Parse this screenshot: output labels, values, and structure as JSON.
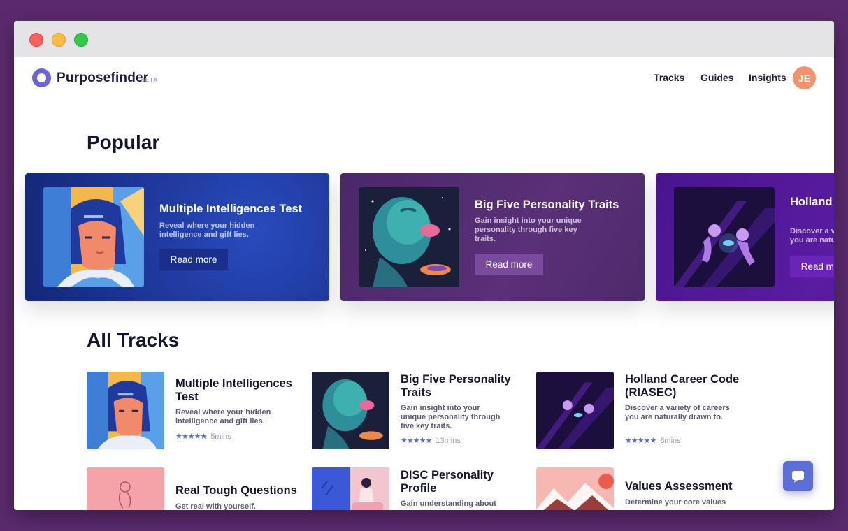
{
  "window": {
    "buttons": [
      "close",
      "minimize",
      "zoom"
    ]
  },
  "nav": {
    "brand": "Purposefinder",
    "badge": "BETA",
    "links": [
      "Tracks",
      "Guides",
      "Insights"
    ],
    "avatar_initials": "JE"
  },
  "popular": {
    "heading": "Popular",
    "cards": [
      {
        "title": "Multiple Intelligences Test",
        "description": "Reveal where your hidden intelligence and gift lies.",
        "button": "Read more",
        "bg": "#1d3a9e",
        "button_bg": "#1a2f8c"
      },
      {
        "title": "Big Five Personality Traits",
        "description": "Gain insight into your unique personality through five key traits.",
        "button": "Read more",
        "bg": "#4f2a6d",
        "button_bg": "#7a4a9c"
      },
      {
        "title": "Holland Career Code (RIASEC)",
        "description": "Discover a variety of careers you are naturally drawn to.",
        "button": "Read more",
        "bg": "#4a1690",
        "button_bg": "#6a24b8"
      }
    ]
  },
  "tracks": {
    "heading": "All Tracks",
    "items": [
      {
        "title": "Multiple Intelligences Test",
        "description": "Reveal where your hidden intelligence and gift lies.",
        "duration": "5mins",
        "rating": 5
      },
      {
        "title": "Big Five Personality Traits",
        "description": "Gain insight into your unique personality through five key traits.",
        "duration": "13mins",
        "rating": 5
      },
      {
        "title": "Holland Career Code (RIASEC)",
        "description": "Discover a variety of careers you are naturally drawn to.",
        "duration": "8mins",
        "rating": 5
      },
      {
        "title": "Real Tough Questions",
        "description": "Get real with yourself."
      },
      {
        "title": "DISC Personality Profile",
        "description": "Gain understanding about"
      },
      {
        "title": "Values Assessment",
        "description": "Determine your core values"
      }
    ]
  },
  "icons": {
    "stars": "★★★★★",
    "chat": "chat-bubble-icon"
  },
  "colors": {
    "background": "#5b2a6e",
    "accent": "#5b6fd6",
    "logo": "#6a64d6",
    "avatar": "#f5926a"
  }
}
